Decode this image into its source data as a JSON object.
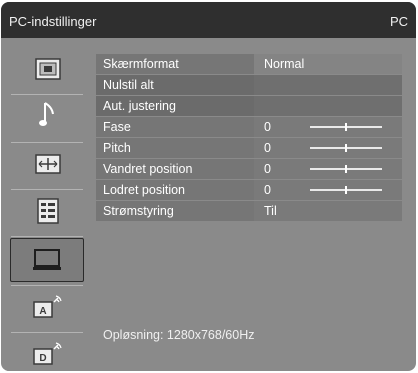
{
  "header": {
    "title": "PC-indstillinger",
    "source": "PC"
  },
  "sidebar": {
    "items": [
      {
        "icon": "picture-icon"
      },
      {
        "icon": "sound-note-icon"
      },
      {
        "icon": "screen-format-icon"
      },
      {
        "icon": "options-list-icon"
      },
      {
        "icon": "pc-monitor-icon",
        "selected": true
      },
      {
        "icon": "analog-antenna-icon"
      },
      {
        "icon": "digital-antenna-icon"
      }
    ]
  },
  "menu": {
    "rows": [
      {
        "label": "Skærmformat",
        "value": "Normal"
      },
      {
        "label": "Nulstil alt",
        "value": ""
      },
      {
        "label": "Aut. justering",
        "value": ""
      },
      {
        "label": "Fase",
        "value": "0",
        "slider": 0.5
      },
      {
        "label": "Pitch",
        "value": "0",
        "slider": 0.5
      },
      {
        "label": "Vandret position",
        "value": "0",
        "slider": 0.5
      },
      {
        "label": "Lodret position",
        "value": "0",
        "slider": 0.5
      },
      {
        "label": "Strømstyring",
        "value": "Til"
      }
    ]
  },
  "status": {
    "resolution": "Opløsning: 1280x768/60Hz"
  }
}
